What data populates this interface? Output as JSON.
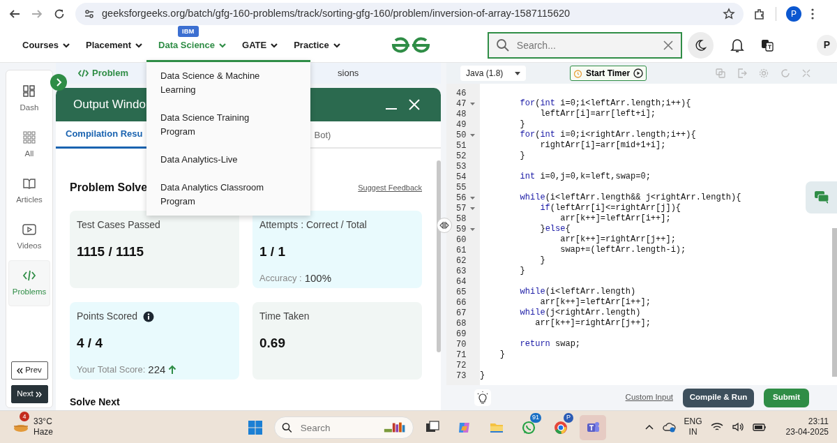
{
  "browser": {
    "url": "geeksforgeeks.org/batch/gfg-160-problems/track/sorting-gfg-160/problem/inversion-of-array-1587115620",
    "profile": "P"
  },
  "site_nav": {
    "items": [
      {
        "label": "Courses",
        "selected": false
      },
      {
        "label": "Placement",
        "selected": false
      },
      {
        "label": "Data Science",
        "selected": true,
        "badge": "IBM"
      },
      {
        "label": "GATE",
        "selected": false
      },
      {
        "label": "Practice",
        "selected": false
      }
    ],
    "dropdown": [
      "Data Science & Machine Learning",
      "Data Science Training Program",
      "Data Analytics-Live",
      "Data Analytics Classroom Program"
    ],
    "search_placeholder": "Search...",
    "avatar": "P"
  },
  "sidebar": {
    "items": [
      {
        "label": "Dash",
        "kind": "dash",
        "selected": false
      },
      {
        "label": "All",
        "kind": "all",
        "selected": false
      },
      {
        "label": "Articles",
        "kind": "articles",
        "selected": false
      },
      {
        "label": "Videos",
        "kind": "videos",
        "selected": false
      },
      {
        "label": "Problems",
        "kind": "problems",
        "selected": true
      }
    ],
    "prev": "Prev",
    "next": "Next"
  },
  "problem_tabs": [
    {
      "label": "Problem",
      "selected": true
    },
    {
      "label": "sions",
      "selected": false
    }
  ],
  "output_window": {
    "title": "Output Windo",
    "tabs": [
      {
        "label": "Compilation Resu",
        "selected": true
      },
      {
        "label": "Bot)",
        "selected": false
      }
    ],
    "heading": "Problem Solve",
    "feedback_link": "Suggest Feedback",
    "stats": [
      {
        "label": "Test Cases Passed",
        "value": "1115 / 1115"
      },
      {
        "label": "Attempts : Correct / Total",
        "value": "1 / 1",
        "sub_label": "Accuracy :",
        "sub_value": "100%"
      },
      {
        "label": "Points Scored",
        "info": true,
        "value": "4 / 4",
        "sub_label": "Your Total Score:",
        "sub_value": "224",
        "rising": true
      },
      {
        "label": "Time Taken",
        "value": "0.69"
      }
    ],
    "solve_next": "Solve Next"
  },
  "editor": {
    "language": "Java (1.8)",
    "timer": "Start Timer",
    "lines": [
      {
        "number": "46",
        "fold": false
      },
      {
        "number": "47",
        "fold": true,
        "code": "        **for**(**int** i=0;i<leftArr.length;i++){"
      },
      {
        "number": "48",
        "fold": false,
        "code": "            leftArr[i]=arr[left+i];"
      },
      {
        "number": "49",
        "fold": false,
        "code": "        }"
      },
      {
        "number": "50",
        "fold": true,
        "code": "        **for**(**int** i=0;i<rightArr.length;i++){"
      },
      {
        "number": "51",
        "fold": false,
        "code": "            rightArr[i]=arr[mid+1+i];"
      },
      {
        "number": "52",
        "fold": false,
        "code": "        }"
      },
      {
        "number": "53",
        "fold": false
      },
      {
        "number": "54",
        "fold": false,
        "code": "        **int** i=0,j=0,k=left,swap=0;"
      },
      {
        "number": "55",
        "fold": false
      },
      {
        "number": "56",
        "fold": true,
        "code": "        **while**(i<leftArr.length&& j<rightArr.length){"
      },
      {
        "number": "57",
        "fold": true,
        "code": "            **if**(leftArr[i]<=rightArr[j]){"
      },
      {
        "number": "58",
        "fold": false,
        "code": "                arr[k++]=leftArr[i++];"
      },
      {
        "number": "59",
        "fold": true,
        "code": "            }**else**{"
      },
      {
        "number": "60",
        "fold": false,
        "code": "                arr[k++]=rightArr[j++];"
      },
      {
        "number": "61",
        "fold": false,
        "code": "                swap+=(leftArr.length-i);"
      },
      {
        "number": "62",
        "fold": false,
        "code": "            }"
      },
      {
        "number": "63",
        "fold": false,
        "code": "        }"
      },
      {
        "number": "64",
        "fold": false
      },
      {
        "number": "65",
        "fold": false,
        "code": "        **while**(i<leftArr.length)"
      },
      {
        "number": "66",
        "fold": false,
        "code": "            arr[k++]=leftArr[i++];"
      },
      {
        "number": "67",
        "fold": false,
        "code": "        **while**(j<rightArr.length)"
      },
      {
        "number": "68",
        "fold": false,
        "code": "           arr[k++]=rightArr[j++];"
      },
      {
        "number": "69",
        "fold": false
      },
      {
        "number": "70",
        "fold": false,
        "code": "        **return** swap;"
      },
      {
        "number": "71",
        "fold": false,
        "code": "    }"
      },
      {
        "number": "72",
        "fold": false
      },
      {
        "number": "73",
        "fold": false,
        "code": "}"
      }
    ],
    "custom_input": "Custom Input",
    "run": "Compile & Run",
    "submit": "Submit"
  },
  "taskbar": {
    "weather": {
      "badge": "4",
      "temperature": "33°C",
      "condition": "Haze"
    },
    "search_placeholder": "Search",
    "apps": [
      {
        "kind": "taskview"
      },
      {
        "kind": "copilot"
      },
      {
        "kind": "files"
      },
      {
        "kind": "whatsapp",
        "badge": "91"
      },
      {
        "kind": "chrome",
        "badge": "P"
      },
      {
        "kind": "teams"
      }
    ],
    "language": "ENG",
    "region": "IN",
    "time": "23:11",
    "date": "23-04-2025"
  }
}
